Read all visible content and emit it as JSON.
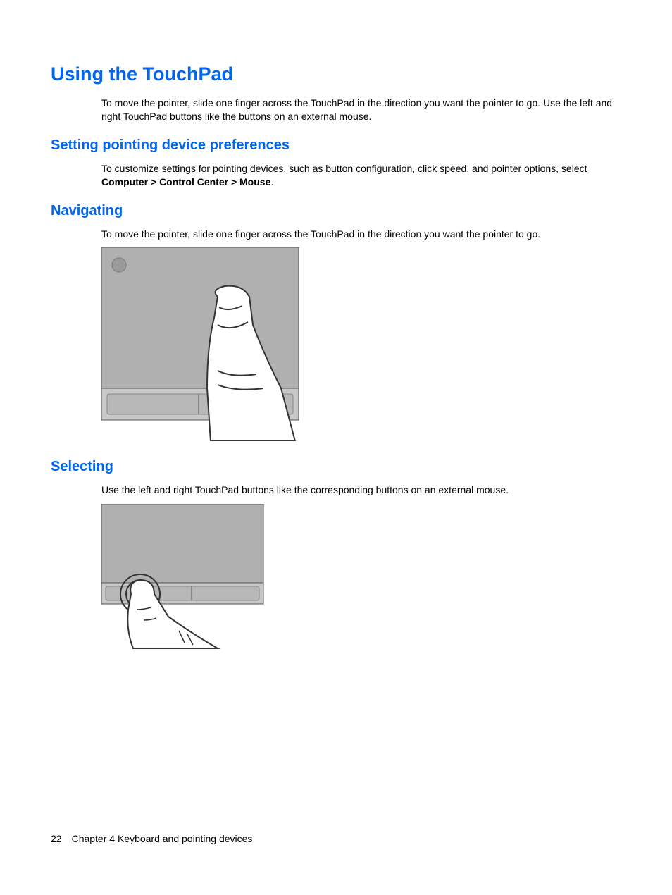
{
  "title": "Using the TouchPad",
  "intro": "To move the pointer, slide one finger across the TouchPad in the direction you want the pointer to go. Use the left and right TouchPad buttons like the buttons on an external mouse.",
  "section1": {
    "heading": "Setting pointing device preferences",
    "text_pre": "To customize settings for pointing devices, such as button configuration, click speed, and pointer options, select ",
    "text_bold": "Computer > Control Center > Mouse",
    "text_post": "."
  },
  "section2": {
    "heading": "Navigating",
    "text": "To move the pointer, slide one finger across the TouchPad in the direction you want the pointer to go."
  },
  "section3": {
    "heading": "Selecting",
    "text": "Use the left and right TouchPad buttons like the corresponding buttons on an external mouse."
  },
  "footer": {
    "page_number": "22",
    "chapter": "Chapter 4   Keyboard and pointing devices"
  }
}
